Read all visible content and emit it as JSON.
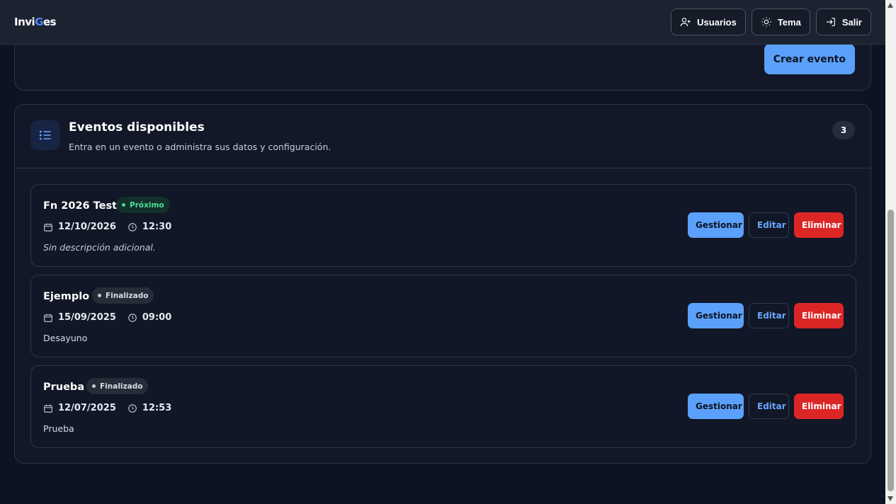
{
  "header": {
    "brand_part1": "Invi",
    "brand_accent": "G",
    "brand_part2": "es",
    "users_label": "Usuarios",
    "theme_label": "Tema",
    "logout_label": "Salir"
  },
  "create_card": {
    "create_label": "Crear evento"
  },
  "events_panel": {
    "title": "Eventos disponibles",
    "subtitle": "Entra en un evento o administra sus datos y configuración.",
    "count": "3",
    "events": [
      {
        "title": "Fn 2026 Test",
        "status": "Próximo",
        "date": "12/10/2026",
        "time": "12:30",
        "description": "Sin descripción adicional."
      },
      {
        "title": "Ejemplo",
        "status": "Finalizado",
        "date": "15/09/2025",
        "time": "09:00",
        "description": "Desayuno"
      },
      {
        "title": "Prueba",
        "status": "Finalizado",
        "date": "12/07/2025",
        "time": "12:53",
        "description": "Prueba"
      }
    ],
    "actions": {
      "manage_label": "Gestionar",
      "edit_label": "Editar",
      "delete_label": "Eliminar"
    }
  },
  "colors": {
    "background": "#0d1322",
    "accent": "#5ba1fb",
    "danger": "#dc2626",
    "success": "#4ade9a"
  },
  "icons": [
    "user-plus-icon",
    "sun-icon",
    "logout-icon",
    "list-icon",
    "calendar-icon",
    "clock-icon"
  ]
}
